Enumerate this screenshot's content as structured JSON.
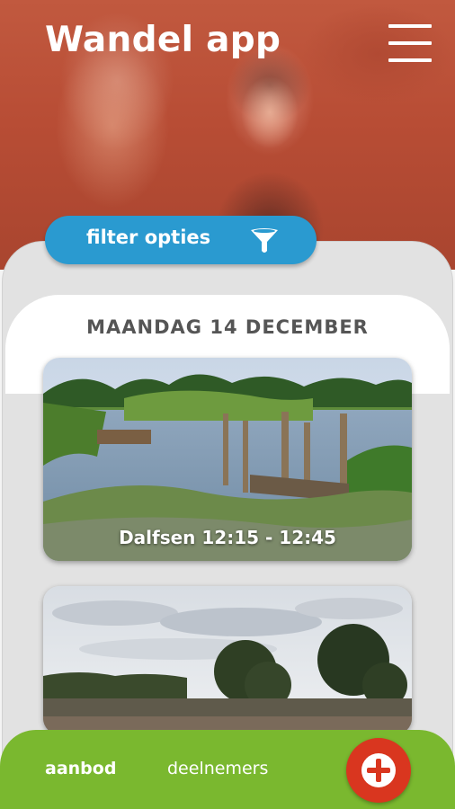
{
  "app": {
    "title": "Wandel app"
  },
  "header": {
    "menu_icon": "hamburger-menu-icon"
  },
  "filter": {
    "label": "filter opties",
    "icon": "funnel-icon"
  },
  "date_heading": "MAANDAG 14 DECEMBER",
  "walks": [
    {
      "label": "Dalfsen 12:15 - 12:45"
    },
    {
      "label": ""
    }
  ],
  "bottom_nav": {
    "tabs": [
      {
        "label": "aanbod",
        "active": true
      },
      {
        "label": "deelnemers",
        "active": false
      }
    ],
    "add_icon": "plus-circle-icon"
  },
  "colors": {
    "hero_tint": "#b84d35",
    "filter_pill": "#2a9ad0",
    "bottom_nav": "#7ab82f",
    "add_button": "#d9361f",
    "date_heading": "#555555"
  }
}
